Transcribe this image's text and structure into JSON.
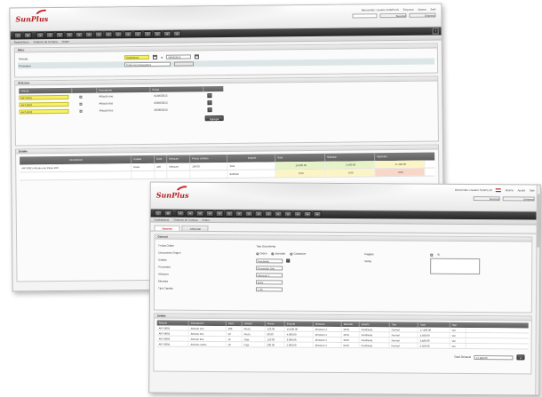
{
  "window1": {
    "logo": "SunPlus",
    "top_links": [
      "Bienvenido: Usuario SUNPLUS",
      "Empresa",
      "Idioma",
      "Salir"
    ],
    "search_placeholder": "",
    "selects": [
      "Sucursal",
      "Empresa"
    ],
    "breadcrumb": [
      "Reabastecer",
      "Ordenes de Compra",
      "Orden"
    ],
    "filter_section": {
      "title": "Filtro",
      "date_label": "Periodo",
      "date_from": "01/06/2013",
      "date_to": "30/06/2013",
      "date_sep": "al",
      "provider_label": "Proveedor",
      "provider_value": "Todos los proveedores"
    },
    "articles_section": {
      "title": "Articulos",
      "header": [
        "Articulo",
        "",
        "Descripcion",
        "Fecha"
      ],
      "rows": [
        {
          "code": "ART-0001",
          "desc": "Articulo uno",
          "date": "01/06/2013"
        },
        {
          "code": "ART-0002",
          "desc": "Articulo dos",
          "date": "03/06/2013"
        },
        {
          "code": "ART-0003",
          "desc": "Articulo tres",
          "date": "05/06/2013"
        }
      ],
      "button": "Agregar"
    },
    "detail_section": {
      "title": "Detalle",
      "header": [
        "Descripcion",
        "Unidad",
        "Cant.",
        "Almacen",
        "Precio Unitario",
        "Importe",
        "Total",
        "Subtotal",
        "Impuesto"
      ],
      "rows": [
        {
          "desc": "ART-0001 Articulo uno Pieza 100",
          "unit": "Pieza",
          "qty": "100",
          "wh": "Almacen",
          "price": "150.00",
          "amount": "Total",
          "c1": "15,000.00",
          "c2": "2,400.00",
          "c3": "17,400.00"
        },
        {
          "desc": "",
          "unit": "",
          "qty": "",
          "wh": "",
          "price": "",
          "amount": "Subtotal",
          "c1": "0.00",
          "c2": "0.00",
          "c3": "0.00"
        }
      ]
    }
  },
  "window2": {
    "logo": "SunPlus",
    "top_links": [
      "Bienvenido: Usuario SUNPLUS",
      "Idioma",
      "Ayuda",
      "Salir"
    ],
    "selects": [
      "Sucursal",
      "Empresa"
    ],
    "breadcrumb": [
      "Reabastecer",
      "Ordenes de Compra",
      "Orden"
    ],
    "tabs": [
      "General",
      "Adicional"
    ],
    "general": {
      "title": "General",
      "left_labels": [
        "Fecha Orden",
        "Documento Origen",
        "Estado",
        "Proveedor",
        "Almacen",
        "Moneda",
        "Tipo Cambio"
      ],
      "left_values": [
        "",
        "",
        "Pendiente",
        "Proveedor Uno",
        "Almacen 1",
        "MXN",
        "1.00"
      ],
      "mid_label": "Tipo Documento",
      "mid_options": [
        "Orden",
        "Borrador",
        "Cotizacion"
      ],
      "right_labels": [
        "Pagado",
        "Notas"
      ],
      "right_checkbox": "Si"
    },
    "detail": {
      "title": "Detalle",
      "header": [
        "Articulo",
        "Descripcion",
        "Cant.",
        "Unidad",
        "Precio",
        "Importe",
        "Almacen",
        "Moneda",
        "Estado",
        "Tipo",
        "Total",
        "Opc."
      ],
      "rows": [
        {
          "c": [
            "ART-0001",
            "Articulo uno",
            "100",
            "Pieza",
            "150.00",
            "15,000.00",
            "Almacen 1",
            "MXN",
            "Pendiente",
            "Normal",
            "17,400.00",
            "Ver"
          ]
        },
        {
          "c": [
            "ART-0002",
            "Articulo dos",
            "50",
            "Pieza",
            "80.00",
            "4,000.00",
            "Almacen 1",
            "MXN",
            "Pendiente",
            "Normal",
            "4,640.00",
            "Ver"
          ]
        },
        {
          "c": [
            "ART-0003",
            "Articulo tres",
            "25",
            "Caja",
            "120.00",
            "3,000.00",
            "Almacen 1",
            "MXN",
            "Pendiente",
            "Normal",
            "3,480.00",
            "Ver"
          ]
        },
        {
          "c": [
            "ART-0004",
            "Articulo cuatro",
            "10",
            "Caja",
            "200.00",
            "2,000.00",
            "Almacen 1",
            "MXN",
            "Pendiente",
            "Normal",
            "2,320.00",
            "Ver"
          ]
        }
      ],
      "total_label": "Total General",
      "total_value": "27,840.00"
    }
  }
}
